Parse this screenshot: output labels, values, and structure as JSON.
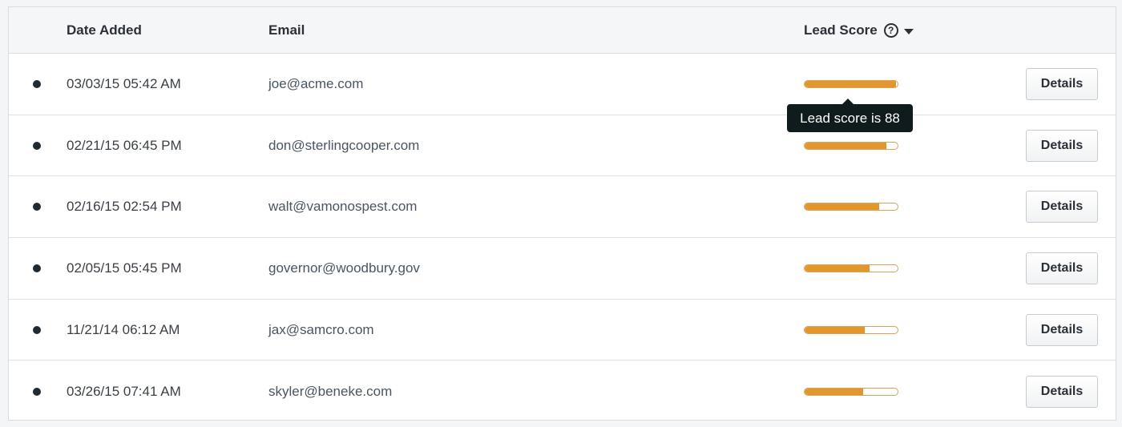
{
  "header": {
    "date_label": "Date Added",
    "email_label": "Email",
    "score_label": "Lead Score",
    "help_icon": "?"
  },
  "rows": [
    {
      "date": "03/03/15 05:42 AM",
      "email": "joe@acme.com",
      "score": 0.98,
      "action": "Details"
    },
    {
      "date": "02/21/15 06:45 PM",
      "email": "don@sterlingcooper.com",
      "score": 0.88,
      "action": "Details"
    },
    {
      "date": "02/16/15 02:54 PM",
      "email": "walt@vamonospest.com",
      "score": 0.8,
      "action": "Details"
    },
    {
      "date": "02/05/15 05:45 PM",
      "email": "governor@woodbury.gov",
      "score": 0.7,
      "action": "Details"
    },
    {
      "date": "11/21/14 06:12 AM",
      "email": "jax@samcro.com",
      "score": 0.65,
      "action": "Details"
    },
    {
      "date": "03/26/15 07:41 AM",
      "email": "skyler@beneke.com",
      "score": 0.63,
      "action": "Details"
    }
  ],
  "tooltip": {
    "text": "Lead score is 88"
  },
  "colors": {
    "bar_fill": "#e3962c",
    "tooltip_bg": "#0f1b1c",
    "status_dot": "#1f2a33"
  }
}
